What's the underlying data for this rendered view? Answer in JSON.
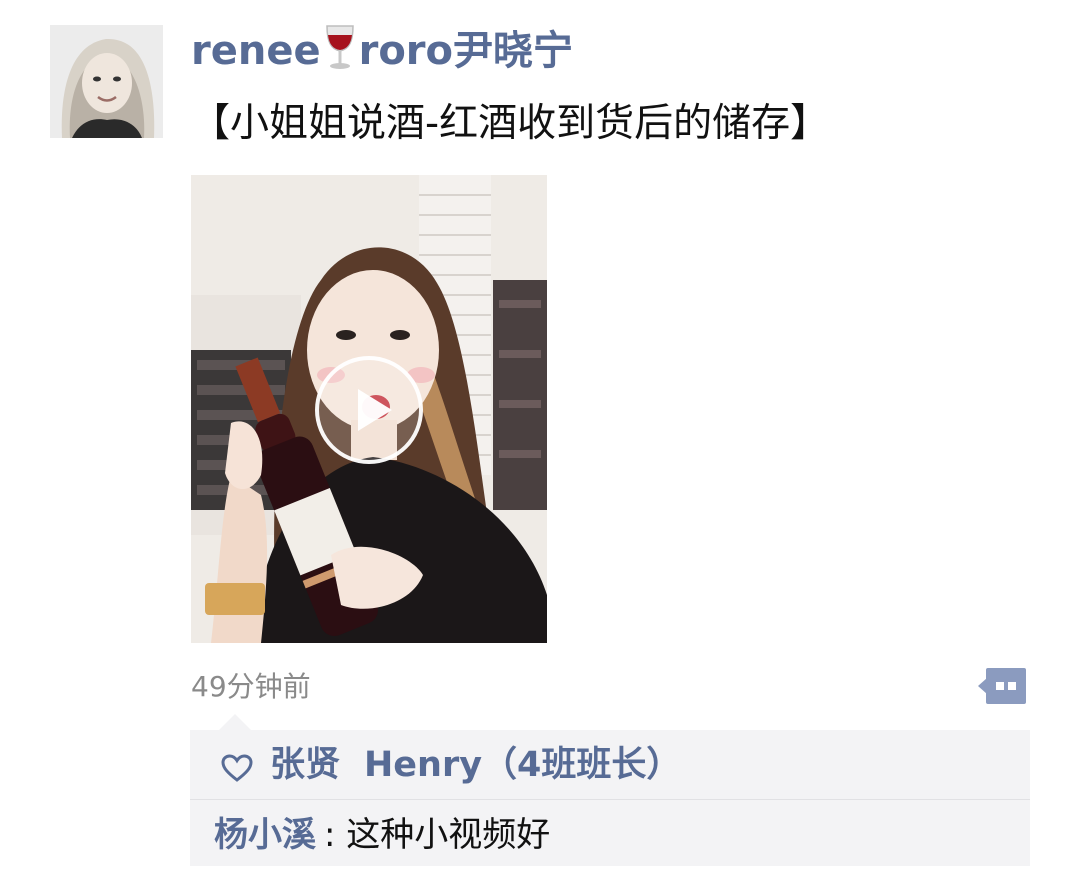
{
  "post": {
    "author": {
      "name_prefix": "renee",
      "name_suffix": "roro尹晓宁",
      "emoji": "wine-glass-icon"
    },
    "text": "【小姐姐说酒-红酒收到货后的储存】",
    "media": {
      "type": "video",
      "play_icon": "play-icon"
    },
    "timestamp": "49分钟前",
    "comment_toggle_icon": "comment-more-icon"
  },
  "interactions": {
    "like_icon": "heart-icon",
    "likers": [
      "张贤",
      "Henry（4班班长）"
    ],
    "comments": [
      {
        "author": "杨小溪",
        "separator": ": ",
        "text": "这种小视频好"
      }
    ]
  },
  "colors": {
    "name_link": "#576b95",
    "timestamp": "#8a8a8a",
    "interaction_bg": "#f3f3f5",
    "comment_toggle": "#8b9bbf"
  }
}
